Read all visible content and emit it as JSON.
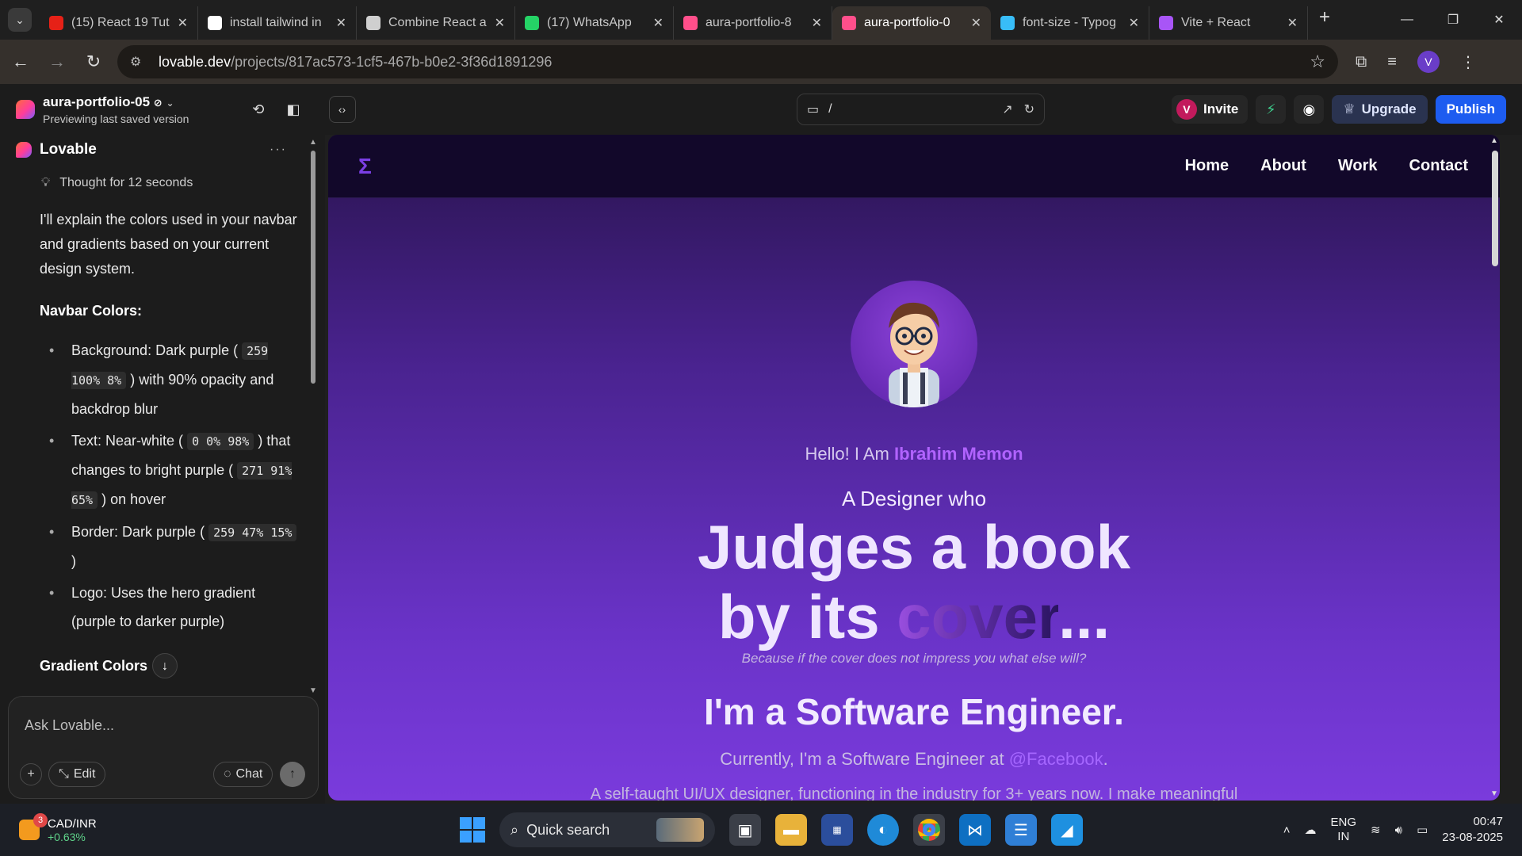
{
  "browser": {
    "tabs": [
      {
        "title": "(15) React 19 Tut",
        "color": "#e62117",
        "icon": "youtube-icon"
      },
      {
        "title": "install tailwind in",
        "color": "#ffffff",
        "icon": "google-icon"
      },
      {
        "title": "Combine React a",
        "color": "#cfcfcf",
        "icon": "openai-icon"
      },
      {
        "title": "(17) WhatsApp",
        "color": "#25d366",
        "icon": "whatsapp-icon"
      },
      {
        "title": "aura-portfolio-8",
        "color": "#ff4f8b",
        "icon": "lovable-icon"
      },
      {
        "title": "aura-portfolio-0",
        "color": "#ff4f8b",
        "icon": "lovable-icon",
        "active": true
      },
      {
        "title": "font-size - Typog",
        "color": "#38bdf8",
        "icon": "tailwind-icon"
      },
      {
        "title": "Vite + React",
        "color": "#a855f7",
        "icon": "vite-icon"
      }
    ],
    "url_host": "lovable.dev",
    "url_path": "/projects/817ac573-1cf5-467b-b0e2-3f36d1891296",
    "profile_initial": "V"
  },
  "lovable": {
    "project_name": "aura-portfolio-05",
    "project_sub": "Previewing last saved version",
    "path": "/",
    "invite_initial": "V",
    "invite_label": "Invite",
    "upgrade_label": "Upgrade",
    "publish_label": "Publish"
  },
  "chat": {
    "sender": "Lovable",
    "thought": "Thought for 12 seconds",
    "intro": "I'll explain the colors used in your navbar and gradients based on your current design system.",
    "navbar_heading": "Navbar Colors:",
    "items": [
      {
        "pre": "Background: Dark purple (",
        "code": "259 100% 8%",
        "post": ") with 90% opacity and backdrop blur"
      },
      {
        "pre": "Text: Near-white (",
        "code": "0 0% 98%",
        "post": ") that changes to bright purple (",
        "code2": "271 91% 65%",
        "post2": ") on hover"
      },
      {
        "pre": "Border: Dark purple (",
        "code": "259 47% 15%",
        "post": ")"
      },
      {
        "pre": "Logo: Uses the hero gradient (purple to darker purple)"
      }
    ],
    "gradient_heading": "Gradient Colors",
    "composer_placeholder": "Ask Lovable...",
    "edit_label": "Edit",
    "chat_label": "Chat"
  },
  "preview": {
    "logo": "Σ",
    "nav": [
      "Home",
      "About",
      "Work",
      "Contact"
    ],
    "hello": "Hello! I Am ",
    "name": "Ibrahim Memon",
    "designer": "A Designer who",
    "line1": "Judges a book",
    "line2_a": "by its ",
    "line2_b": "cover",
    "line2_c": "...",
    "tagline": "Because if the cover does not impress you what else will?",
    "se": "I'm a Software Engineer.",
    "current_a": "Currently, I'm a Software Engineer at ",
    "current_b": "@Facebook",
    "current_c": ".",
    "selftaught": "A self-taught UI/UX designer, functioning in the industry for 3+ years now. I make meaningful"
  },
  "taskbar": {
    "ticker_badge": "3",
    "ticker_name": "CAD/INR",
    "ticker_change": "+0.63%",
    "search": "Quick search",
    "lang1": "ENG",
    "lang2": "IN",
    "time": "00:47",
    "date": "23-08-2025"
  }
}
